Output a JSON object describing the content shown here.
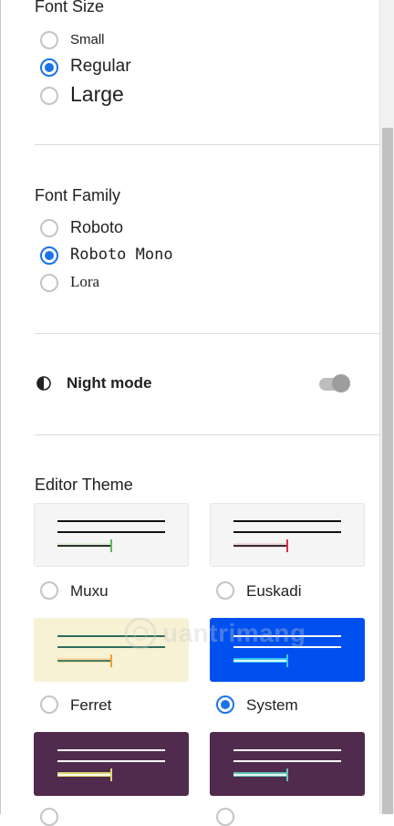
{
  "font_size": {
    "title": "Font Size",
    "options": [
      {
        "label": "Small",
        "checked": false
      },
      {
        "label": "Regular",
        "checked": true
      },
      {
        "label": "Large",
        "checked": false
      }
    ]
  },
  "font_family": {
    "title": "Font Family",
    "options": [
      {
        "label": "Roboto",
        "checked": false
      },
      {
        "label": "Roboto Mono",
        "checked": true
      },
      {
        "label": "Lora",
        "checked": false
      }
    ]
  },
  "night_mode": {
    "label": "Night mode",
    "enabled": false,
    "icon": "half-circle-contrast-icon"
  },
  "editor_theme": {
    "title": "Editor Theme",
    "themes": [
      {
        "name": "Muxu",
        "checked": false,
        "bg": "#f5f5f5",
        "line": "#111111",
        "highlight": "#dff0d8",
        "cursor": "#5cb85c"
      },
      {
        "name": "Euskadi",
        "checked": false,
        "bg": "#f5f5f5",
        "line": "#111111",
        "highlight": "#f5d7dc",
        "cursor": "#d9304f"
      },
      {
        "name": "Ferret",
        "checked": false,
        "bg": "#f7f2d4",
        "line": "#2e6b5e",
        "highlight": "#f7d9a0",
        "cursor": "#f0a030"
      },
      {
        "name": "System",
        "checked": true,
        "bg": "#0050f0",
        "line": "#ffffff",
        "highlight": "#3ac7f0",
        "cursor": "#3ac7f0"
      },
      {
        "name": "",
        "checked": false,
        "bg": "#512b4e",
        "line": "#ffffff",
        "highlight": "#d9d870",
        "cursor": "#d9d870"
      },
      {
        "name": "",
        "checked": false,
        "bg": "#512b4e",
        "line": "#ffffff",
        "highlight": "#63c1b4",
        "cursor": "#63c1b4"
      }
    ]
  },
  "watermark": {
    "text": "uantrimang"
  },
  "colors": {
    "accent": "#1a73e8",
    "divider": "#dadce0"
  }
}
